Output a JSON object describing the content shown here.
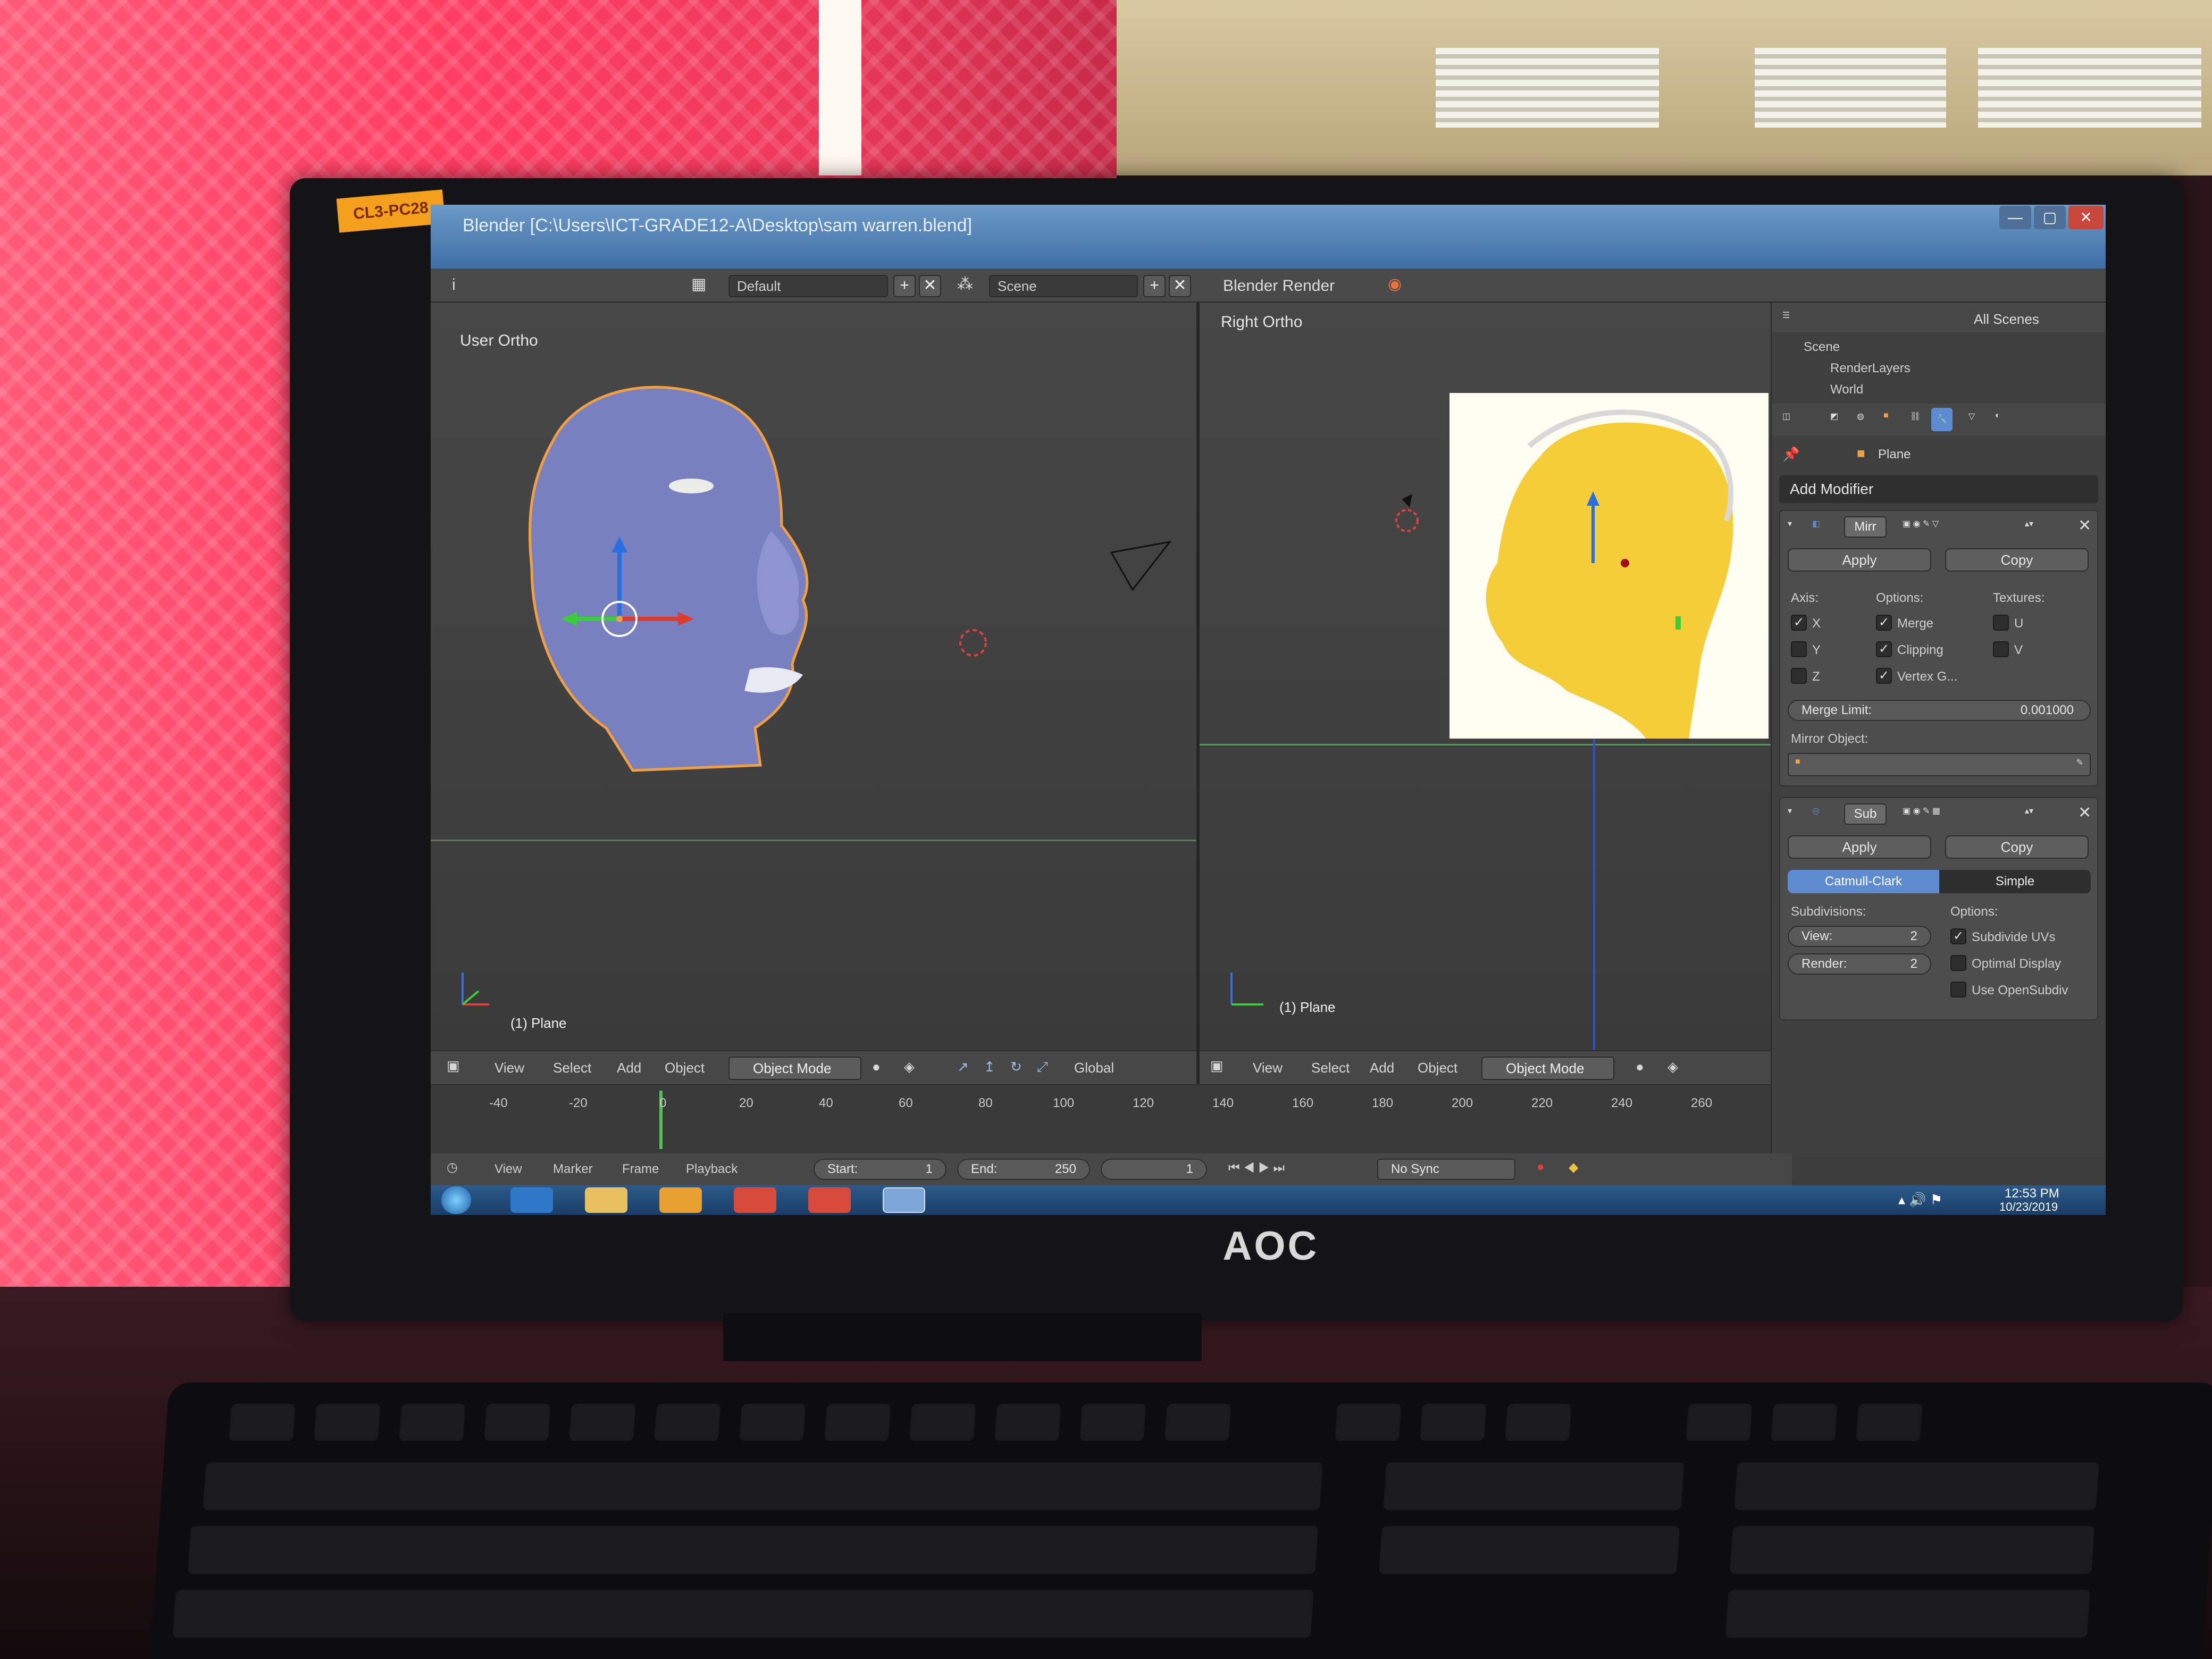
{
  "sticker": "CL3-PC28",
  "monitor_brand": "AOC",
  "window": {
    "title": "Blender [C:\\Users\\ICT-GRADE12-A\\Desktop\\sam warren.blend]",
    "min": "—",
    "max": "▢",
    "close": "✕"
  },
  "header": {
    "info_icon": "i",
    "layout_value": "Default",
    "scene_value": "Scene",
    "engine": "Blender Render",
    "add": "+",
    "remove": "✕"
  },
  "outliner": {
    "filter": "All Scenes",
    "rows": [
      "Scene",
      "RenderLayers",
      "World"
    ]
  },
  "left_viewport": {
    "label": "User Ortho",
    "object": "(1) Plane",
    "menus": [
      "View",
      "Select",
      "Add",
      "Object"
    ],
    "mode": "Object Mode",
    "orientation": "Global"
  },
  "right_viewport": {
    "label": "Right Ortho",
    "object": "(1) Plane",
    "menus": [
      "View",
      "Select",
      "Add",
      "Object"
    ],
    "mode": "Object Mode"
  },
  "timeline": {
    "ticks": [
      "-40",
      "-20",
      "0",
      "20",
      "40",
      "60",
      "80",
      "100",
      "120",
      "140",
      "160",
      "180",
      "200",
      "220",
      "240",
      "260"
    ],
    "menus": [
      "View",
      "Marker",
      "Frame",
      "Playback"
    ],
    "start_label": "Start:",
    "start_value": "1",
    "end_label": "End:",
    "end_value": "250",
    "current_frame": "1",
    "sync": "No Sync"
  },
  "properties": {
    "object_name": "Plane",
    "add_modifier": "Add Modifier",
    "mirror": {
      "name": "Mirr",
      "apply": "Apply",
      "copy": "Copy",
      "axis_label": "Axis:",
      "options_label": "Options:",
      "textures_label": "Textures:",
      "axes": [
        {
          "label": "X",
          "checked": true
        },
        {
          "label": "Y",
          "checked": false
        },
        {
          "label": "Z",
          "checked": false
        }
      ],
      "options": [
        {
          "label": "Merge",
          "checked": true
        },
        {
          "label": "Clipping",
          "checked": true
        },
        {
          "label": "Vertex G...",
          "checked": true
        }
      ],
      "textures": [
        {
          "label": "U",
          "checked": false
        },
        {
          "label": "V",
          "checked": false
        }
      ],
      "merge_limit_label": "Merge Limit:",
      "merge_limit_value": "0.001000",
      "mirror_object_label": "Mirror Object:"
    },
    "subsurf": {
      "name": "Sub",
      "apply": "Apply",
      "copy": "Copy",
      "tab_catmull": "Catmull-Clark",
      "tab_simple": "Simple",
      "subdivisions_label": "Subdivisions:",
      "options_label": "Options:",
      "view_label": "View:",
      "view_value": "2",
      "render_label": "Render:",
      "render_value": "2",
      "opt_subdivide_uvs": "Subdivide UVs",
      "opt_optimal_display": "Optimal Display",
      "opt_use_opensubdiv": "Use OpenSubdiv"
    }
  },
  "taskbar": {
    "time": "12:53 PM",
    "date": "10/23/2019"
  },
  "colors": {
    "accent_blue": "#5c8ccf",
    "selection_orange": "#f0a040",
    "head_fill": "#7880c0",
    "ref_yellow": "#f2c418"
  }
}
